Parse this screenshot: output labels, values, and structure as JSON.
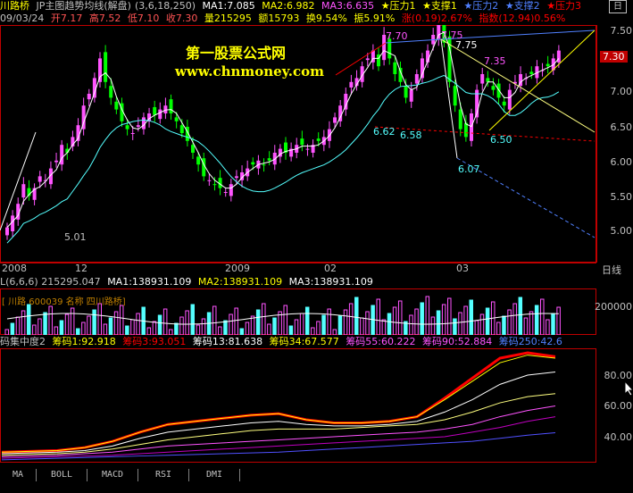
{
  "header": {
    "stock": "川路桥",
    "indicator_name": "JP主图趋势均线(解盘)",
    "params": "(3,6,18,250)",
    "ma1": "MA1:7.085",
    "ma2": "MA2:6.982",
    "ma3": "MA3:6.635",
    "resist1": "★压力1",
    "support1": "★支撑1",
    "resist2": "★压力2",
    "support2": "★支撑2",
    "resist3": "★压力3",
    "end_flag": "日"
  },
  "quote": {
    "date": "09/03/24",
    "open": "开7.17",
    "high": "高7.52",
    "low": "低7.10",
    "close": "收7.30",
    "volume": "量215295",
    "amount": "额15793",
    "turnover": "换9.54%",
    "amplitude": "振5.91%",
    "change": "涨(0.19)2.67%",
    "index": "指数(12.94)0.56%"
  },
  "watermark": {
    "title": "第一股票公式网",
    "url": "www.chnmoney.com"
  },
  "main_chart": {
    "price_labels": [
      "7.50",
      "7.00",
      "6.50",
      "6.00",
      "5.50",
      "5.00"
    ],
    "last_price": "7.30",
    "annotations": [
      "7.70",
      "7.75",
      "7.75",
      "7.35",
      "6.62",
      "6.58",
      "6.50",
      "6.07",
      "5.01"
    ],
    "date_labels": [
      "2008",
      "12",
      "2009",
      "02",
      "03"
    ],
    "period_label": "日线"
  },
  "volume_panel": {
    "header": "L(6,6,6) 215295.047",
    "ma1": "MA1:138931.109",
    "ma2": "MA2:138931.109",
    "ma3": "MA3:138931.109",
    "overlay_label": "[ 川路 600039 名称 四川路桥]",
    "axis_label": "200000"
  },
  "chip_panel": {
    "title": "码集中度2",
    "c1": "筹码1:92.918",
    "c3": "筹码3:93.051",
    "c13": "筹码13:81.638",
    "c34": "筹码34:67.577",
    "c55": "筹码55:60.222",
    "c90": "筹码90:52.884",
    "c250": "筹码250:42.6",
    "axis_labels": [
      "80.00",
      "60.00",
      "40.00"
    ]
  },
  "tabs": [
    "MA",
    "BOLL",
    "MACD",
    "RSI",
    "DMI"
  ],
  "colors": {
    "up": "#ff54ff",
    "down": "#00ff00",
    "cyan": "#54ffff",
    "yellow": "#ffff00",
    "red": "#ff0000",
    "blue": "#5080ff",
    "grid": "#c00000"
  }
}
